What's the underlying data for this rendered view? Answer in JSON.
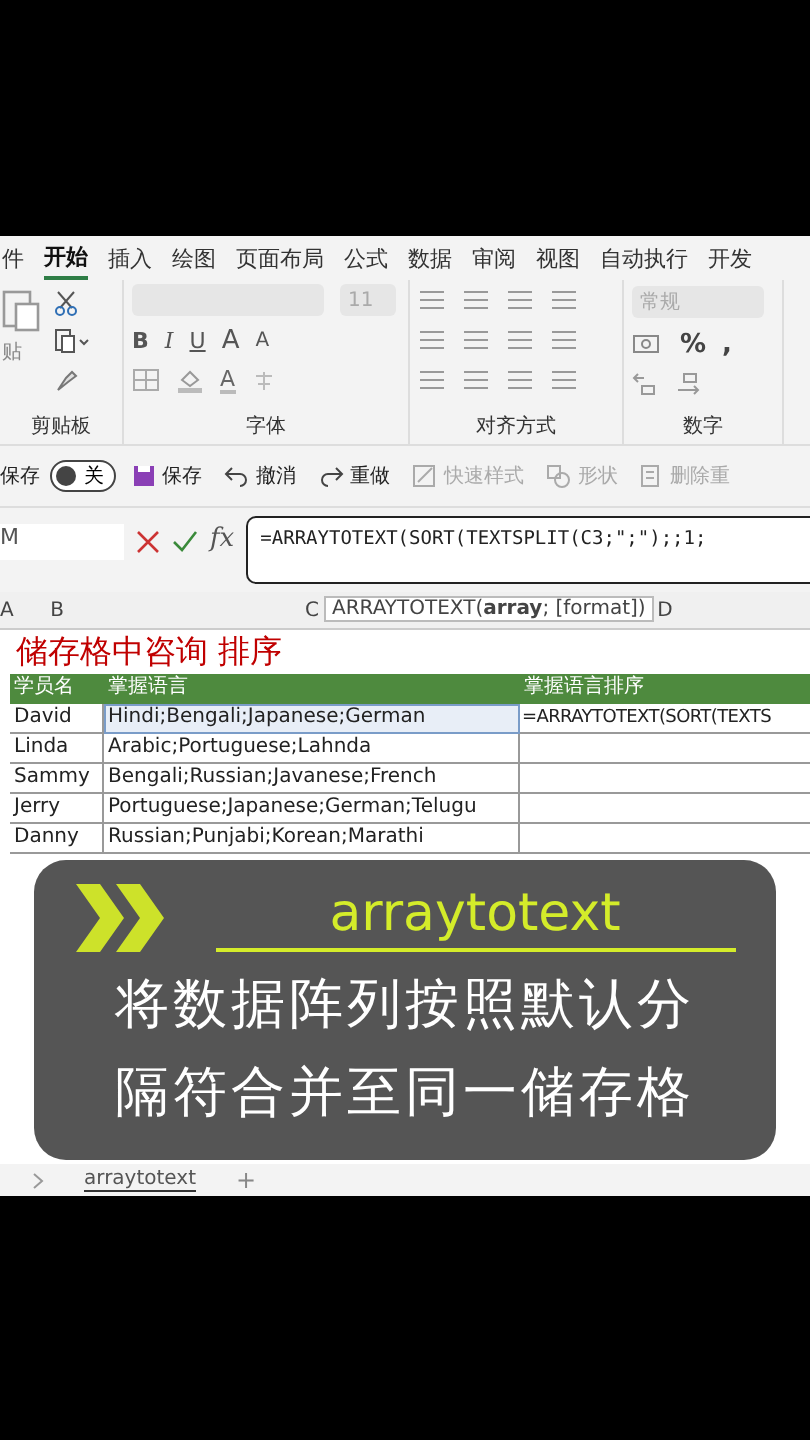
{
  "ribbon_tabs": [
    {
      "label": "件",
      "selected": false
    },
    {
      "label": "开始",
      "selected": true
    },
    {
      "label": "插入",
      "selected": false
    },
    {
      "label": "绘图",
      "selected": false
    },
    {
      "label": "页面布局",
      "selected": false
    },
    {
      "label": "公式",
      "selected": false
    },
    {
      "label": "数据",
      "selected": false
    },
    {
      "label": "审阅",
      "selected": false
    },
    {
      "label": "视图",
      "selected": false
    },
    {
      "label": "自动执行",
      "selected": false
    },
    {
      "label": "开发",
      "selected": false
    }
  ],
  "ribbon": {
    "paste_label": "贴",
    "font_size": "11",
    "format_buttons": [
      {
        "label": "B",
        "kind": "bold"
      },
      {
        "label": "I",
        "kind": "italic"
      },
      {
        "label": "U",
        "kind": "underline"
      },
      {
        "label": "A",
        "kind": "grow"
      },
      {
        "label": "A",
        "kind": "shrink"
      }
    ],
    "font_color_label": "A",
    "number_format": "常规",
    "number_buttons": [
      "%",
      ","
    ],
    "groups": [
      "剪贴板",
      "字体",
      "对齐方式",
      "数字"
    ]
  },
  "quick_toolbar": {
    "autosave_label": "保存",
    "autosave_toggle": {
      "label": "关",
      "on": false
    },
    "items": [
      {
        "label": "保存",
        "kind": "save",
        "disabled": false
      },
      {
        "label": "撤消",
        "kind": "undo",
        "disabled": false
      },
      {
        "label": "重做",
        "kind": "redo",
        "disabled": false
      },
      {
        "label": "快速样式",
        "kind": "styles",
        "disabled": true
      },
      {
        "label": "形状",
        "kind": "shapes",
        "disabled": true
      },
      {
        "label": "删除重",
        "kind": "dedupe",
        "disabled": true
      }
    ]
  },
  "formula_bar": {
    "name_box": "M",
    "fx": "fx",
    "formula": "=ARRAYTOTEXT(SORT(TEXTSPLIT(C3;\";\");;1;"
  },
  "columns": [
    "A",
    "B",
    "C",
    "D"
  ],
  "tooltip": "ARRAYTOTEXT(**array**; [format])",
  "sheet": {
    "title": "储存格中咨询 排序",
    "headers": [
      "学员名",
      "掌握语言",
      "掌握语言排序"
    ],
    "rows": [
      {
        "name": "David",
        "languages": "Hindi;Bengali;Japanese;German",
        "sorted": "=ARRAYTOTEXT(SORT(TEXTS",
        "selected": true
      },
      {
        "name": "Linda",
        "languages": "Arabic;Portuguese;Lahnda",
        "selected": false
      },
      {
        "name": "Sammy",
        "languages": "Bengali;Russian;Javanese;French",
        "selected": false
      },
      {
        "name": "Jerry",
        "languages": "Portuguese;Japanese;German;Telugu",
        "selected": false
      },
      {
        "name": "Danny",
        "languages": "Russian;Punjabi;Korean;Marathi",
        "selected": false
      }
    ]
  },
  "sheet_tabs": [
    {
      "label": "arraytotext",
      "selected": true
    }
  ],
  "add_sheet": "+",
  "overlay": {
    "title": "arraytotext",
    "lines": [
      "将数据阵列按照默认分",
      "隔符合并至同一储存格"
    ]
  }
}
